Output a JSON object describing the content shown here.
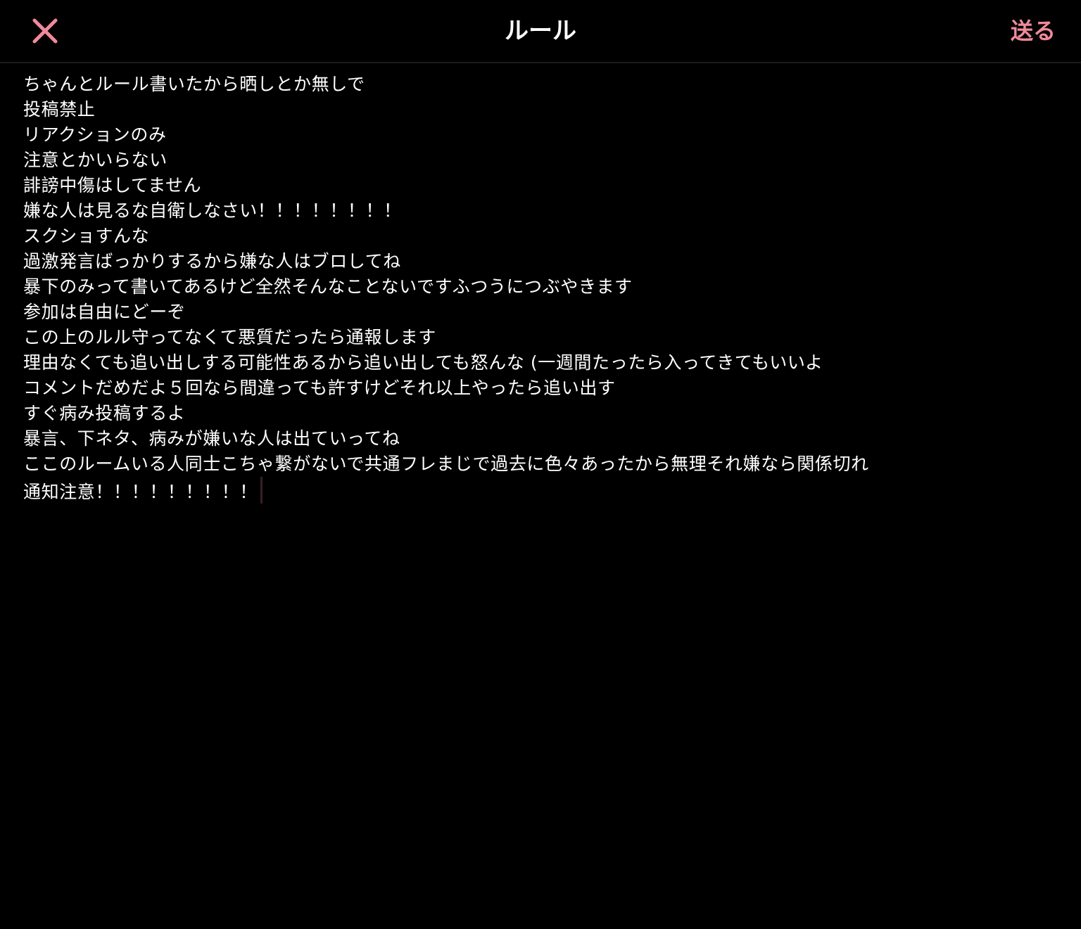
{
  "header": {
    "title": "ルール",
    "send_label": "送る",
    "close_icon": "close-icon",
    "accent_color": "#f08a9b"
  },
  "editor": {
    "lines": [
      "ちゃんとルール書いたから晒しとか無しで",
      "投稿禁止",
      "リアクションのみ",
      "注意とかいらない",
      "誹謗中傷はしてません",
      "嫌な人は見るな自衛しなさい！！！！！！！！",
      "スクショすんな",
      "過激発言ばっかりするから嫌な人はブロしてね",
      "暴下のみって書いてあるけど全然そんなことないですふつうにつぶやきます",
      "参加は自由にどーぞ",
      "この上のルル守ってなくて悪質だったら通報します",
      "理由なくても追い出しする可能性あるから追い出しても怒んな (一週間たったら入ってきてもいいよ",
      "コメントだめだよ５回なら間違っても許すけどそれ以上やったら追い出す",
      "すぐ病み投稿するよ",
      "暴言、下ネタ、病みが嫌いな人は出ていってね",
      "ここのルームいる人同士こちゃ繋がないで共通フレまじで過去に色々あったから無理それ嫌なら関係切れ",
      "通知注意！！！！！！！！！"
    ]
  }
}
